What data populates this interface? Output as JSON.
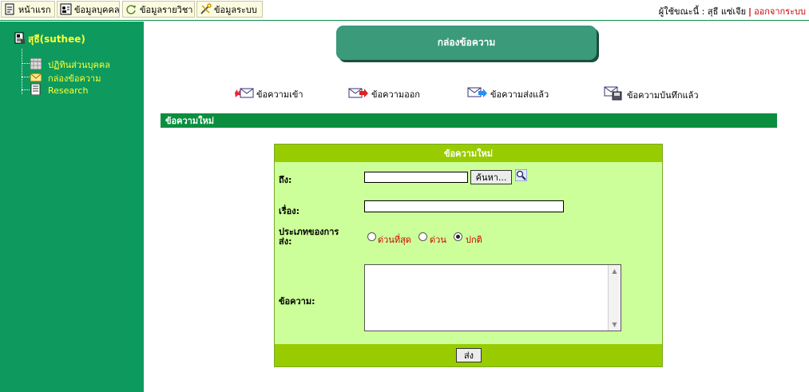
{
  "topbar": {
    "tabs": [
      {
        "label": "หน้าแรก",
        "icon": "document-icon"
      },
      {
        "label": "ข้อมูลบุคคล",
        "icon": "person-card-icon"
      },
      {
        "label": "ข้อมูลรายวิชา",
        "icon": "refresh-icon"
      },
      {
        "label": "ข้อมูลระบบ",
        "icon": "tools-icon"
      }
    ],
    "user_prefix": "ผู้ใช้ขณะนี้ : ",
    "user_name": "สุธี แซ่เจีย",
    "logout_label": "ออกจากระบบ"
  },
  "sidebar": {
    "user_label": "สุธี(suthee)",
    "items": [
      {
        "label": "ปฏิทินส่วนบุคคล",
        "icon": "calendar-icon"
      },
      {
        "label": "กล่องข้อความ",
        "icon": "envelope-icon"
      },
      {
        "label": "Research",
        "icon": "document-icon"
      }
    ]
  },
  "header": {
    "title": "กล่องข้อความ"
  },
  "mailbox_links": [
    {
      "label": "ข้อความเข้า",
      "icon": "inbox-mail-icon"
    },
    {
      "label": "ข้อความออก",
      "icon": "outbox-mail-icon"
    },
    {
      "label": "ข้อความส่งแล้ว",
      "icon": "sent-mail-icon"
    },
    {
      "label": "ข้อความบันทึกแล้ว",
      "icon": "saved-mail-icon"
    }
  ],
  "section_title": "ข้อความใหม่",
  "form": {
    "title": "ข้อความใหม่",
    "to_label": "ถึง:",
    "to_value": "",
    "search_button": "ค้นหา...",
    "subject_label": "เรื่อง:",
    "subject_value": "",
    "type_label": "ประเภทของการส่ง:",
    "type_options": [
      "ด่วนที่สุด",
      "ด่วน",
      "ปกติ"
    ],
    "type_selected": "ปกติ",
    "message_label": "ข้อความ:",
    "message_value": "",
    "send_button": "ส่ง"
  },
  "colors": {
    "sidebar_bg": "#0e9a5e",
    "accent_green": "#0b8f3f",
    "form_bg": "#ccff99",
    "form_header": "#99cc00",
    "header_pill": "#3a9a7a",
    "sidebar_text": "#ffff33",
    "alert_red": "#cc0000"
  }
}
